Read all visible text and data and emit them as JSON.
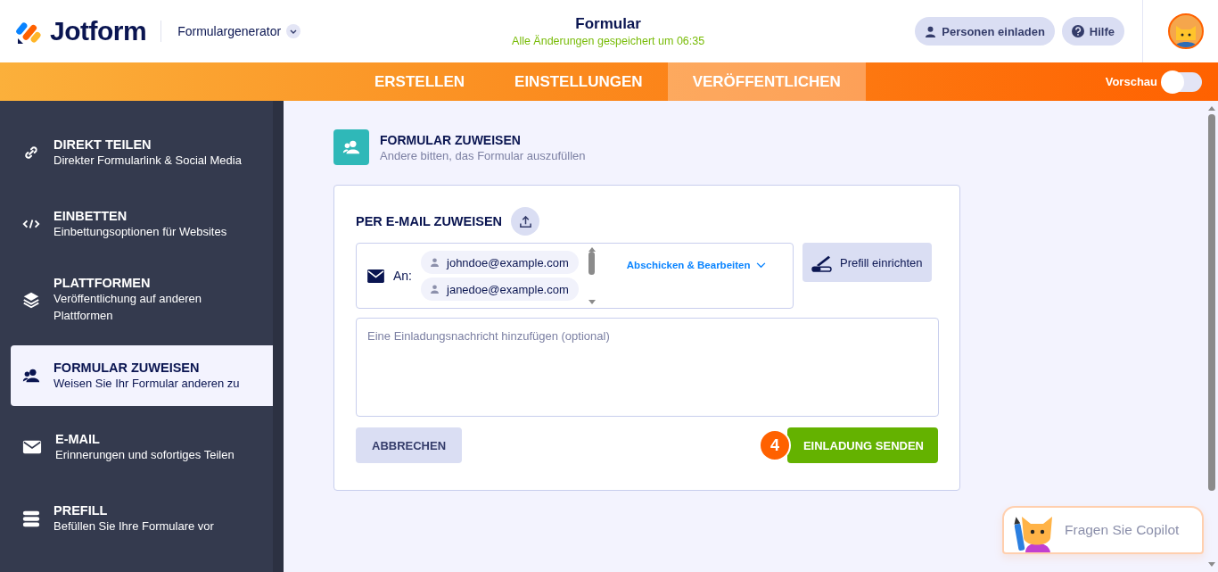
{
  "header": {
    "logo": "Jotform",
    "builder_menu": "Formulargenerator",
    "title": "Formular",
    "save_status": "Alle Änderungen gespeichert um 06:35",
    "buttons": [
      {
        "kind": "invite",
        "label": "Personen einladen"
      },
      {
        "kind": "help",
        "label": "Hilfe"
      }
    ]
  },
  "tabs": [
    {
      "label": "ERSTELLEN",
      "selected": false
    },
    {
      "label": "EINSTELLUNGEN",
      "selected": false
    },
    {
      "label": "VERÖFFENTLICHEN",
      "selected": true
    }
  ],
  "preview": {
    "label": "Vorschau",
    "on": false
  },
  "sidebar": {
    "items": [
      {
        "title": "DIREKT TEILEN",
        "subtitle": "Direkter Formularlink & Social Media",
        "selected": false
      },
      {
        "title": "EINBETTEN",
        "subtitle": "Einbettungsoptionen für Websites",
        "selected": false
      },
      {
        "title": "PLATTFORMEN",
        "subtitle": "Veröffentlichung auf anderen Plattformen",
        "selected": false
      },
      {
        "title": "FORMULAR ZUWEISEN",
        "subtitle": "Weisen Sie Ihr Formular anderen zu",
        "selected": true
      },
      {
        "title": "E-MAIL",
        "subtitle": "Erinnerungen und sofortiges Teilen",
        "selected": false
      },
      {
        "title": "PREFILL",
        "subtitle": "Befüllen Sie Ihre Formulare vor",
        "selected": false
      }
    ]
  },
  "panel": {
    "title": "FORMULAR ZUWEISEN",
    "subtitle": "Andere bitten, das Formular auszufüllen",
    "section_title": "PER E-MAIL ZUWEISEN",
    "to_label": "An:",
    "recipients": [
      "johndoe@example.com",
      "janedoe@example.com"
    ],
    "permission": "Abschicken & Bearbeiten",
    "prefill_button": "Prefill einrichten",
    "message": {
      "placeholder": "Eine Einladungsnachricht hinzufügen (optional)"
    },
    "cancel_button": "ABBRECHEN",
    "step_badge": "4",
    "send_button": "EINLADUNG SENDEN"
  },
  "copilot": {
    "label": "Fragen Sie Copilot"
  }
}
